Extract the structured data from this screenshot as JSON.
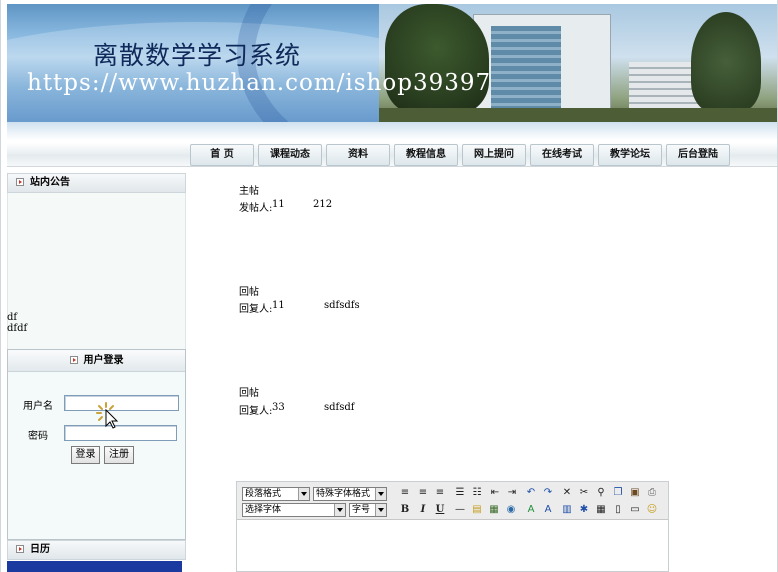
{
  "banner": {
    "title": "离散数学学习系统",
    "watermark_url": "https://www.huzhan.com/ishop39397"
  },
  "nav": [
    {
      "label": "首 页"
    },
    {
      "label": "课程动态"
    },
    {
      "label": "资料"
    },
    {
      "label": "教程信息"
    },
    {
      "label": "网上提问"
    },
    {
      "label": "在线考试"
    },
    {
      "label": "教学论坛"
    },
    {
      "label": "后台登陆"
    }
  ],
  "sidebar": {
    "notice": {
      "title": "站内公告",
      "lines": [
        "df",
        "dfdf"
      ]
    },
    "login": {
      "title": "用户登录",
      "username_label": "用户名",
      "password_label": "密码",
      "username_value": "",
      "password_value": "",
      "login_button": "登录",
      "register_button": "注册"
    },
    "calendar": {
      "title": "日历"
    }
  },
  "posts": [
    {
      "type": "主帖",
      "author_label": "发帖人:",
      "author": "11",
      "content": "212"
    },
    {
      "type": "回帖",
      "author_label": "回复人:",
      "author": "11",
      "content": "sdfsdfs"
    },
    {
      "type": "回帖",
      "author_label": "回复人:",
      "author": "33",
      "content": "sdfsdf"
    }
  ],
  "editor": {
    "paragraph_format": "段落格式",
    "special_font_format": "特殊字体格式",
    "font_select": "选择字体",
    "font_size": "字号"
  },
  "colors": {
    "accent_bar": "#1a3aa0",
    "banner_sky": "#87b7df"
  }
}
